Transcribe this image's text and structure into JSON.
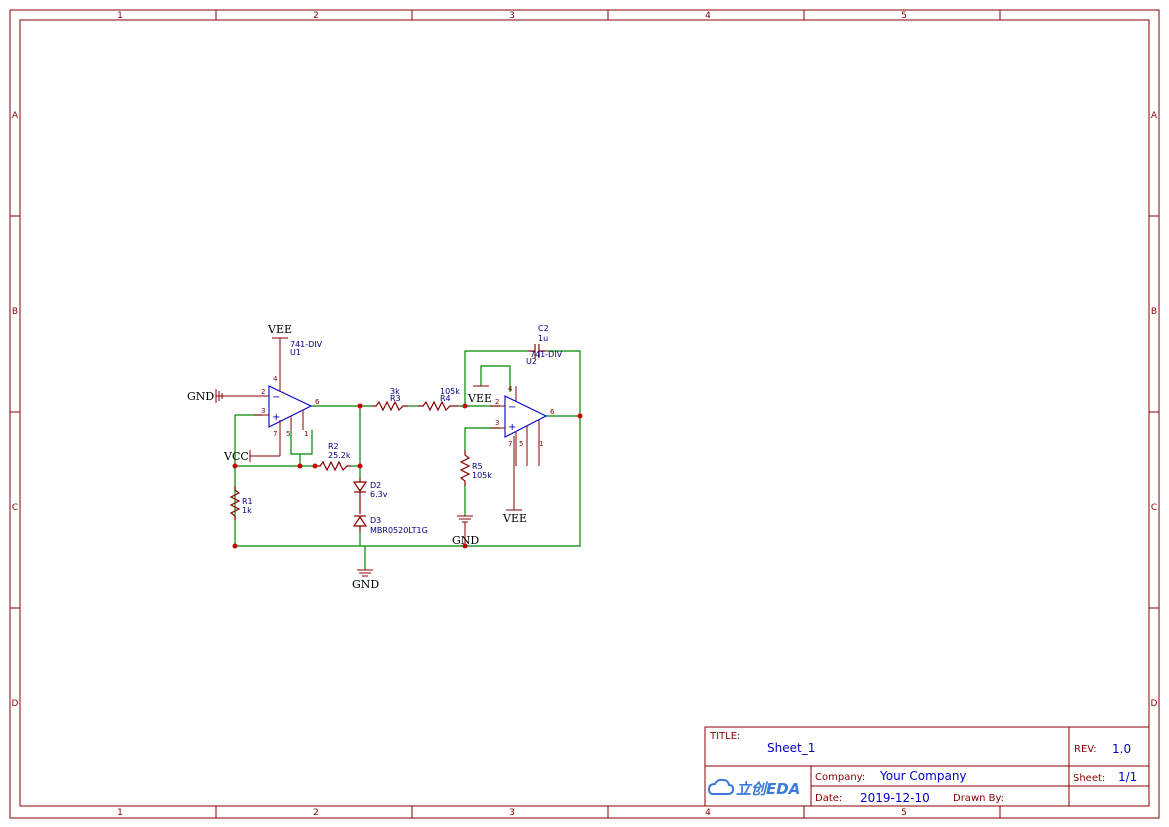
{
  "zones": {
    "columns": [
      "1",
      "2",
      "3",
      "4",
      "5"
    ],
    "rows": [
      "A",
      "B",
      "C",
      "D"
    ]
  },
  "nets": {
    "vee_u1": "VEE",
    "gnd_u1_input": "GND",
    "vcc": "VCC",
    "gnd_diode": "GND",
    "vee_u2_top": "VEE",
    "vee_u2_bottom": "VEE",
    "gnd_r5": "GND"
  },
  "components": {
    "u1": {
      "value": "741-DIV",
      "ref": "U1",
      "pins": [
        "2",
        "3",
        "4",
        "5",
        "6",
        "7",
        "1"
      ]
    },
    "u2": {
      "value": "741-DIV",
      "ref": "U2",
      "pins": [
        "2",
        "3",
        "4",
        "5",
        "6",
        "7",
        "1"
      ]
    },
    "r1": {
      "ref": "R1",
      "value": "1k"
    },
    "r2": {
      "ref": "R2",
      "value": "25.2k"
    },
    "r3": {
      "ref": "R3",
      "value": "3k"
    },
    "r4": {
      "ref": "R4",
      "value": "105k"
    },
    "r5": {
      "ref": "R5",
      "value": "105k"
    },
    "c2": {
      "ref": "C2",
      "value": "1u"
    },
    "d2": {
      "ref": "D2",
      "value": "6.3v"
    },
    "d3": {
      "ref": "D3",
      "value": "MBR0520LT1G"
    }
  },
  "title_block": {
    "title_label": "TITLE:",
    "title": "Sheet_1",
    "rev_label": "REV:",
    "rev": "1.0",
    "company_label": "Company:",
    "company": "Your Company",
    "sheet_label": "Sheet:",
    "sheet": "1/1",
    "date_label": "Date:",
    "date": "2019-12-10",
    "drawn_by_label": "Drawn By:",
    "drawn_by": "",
    "logo_text": "立创EDA"
  }
}
